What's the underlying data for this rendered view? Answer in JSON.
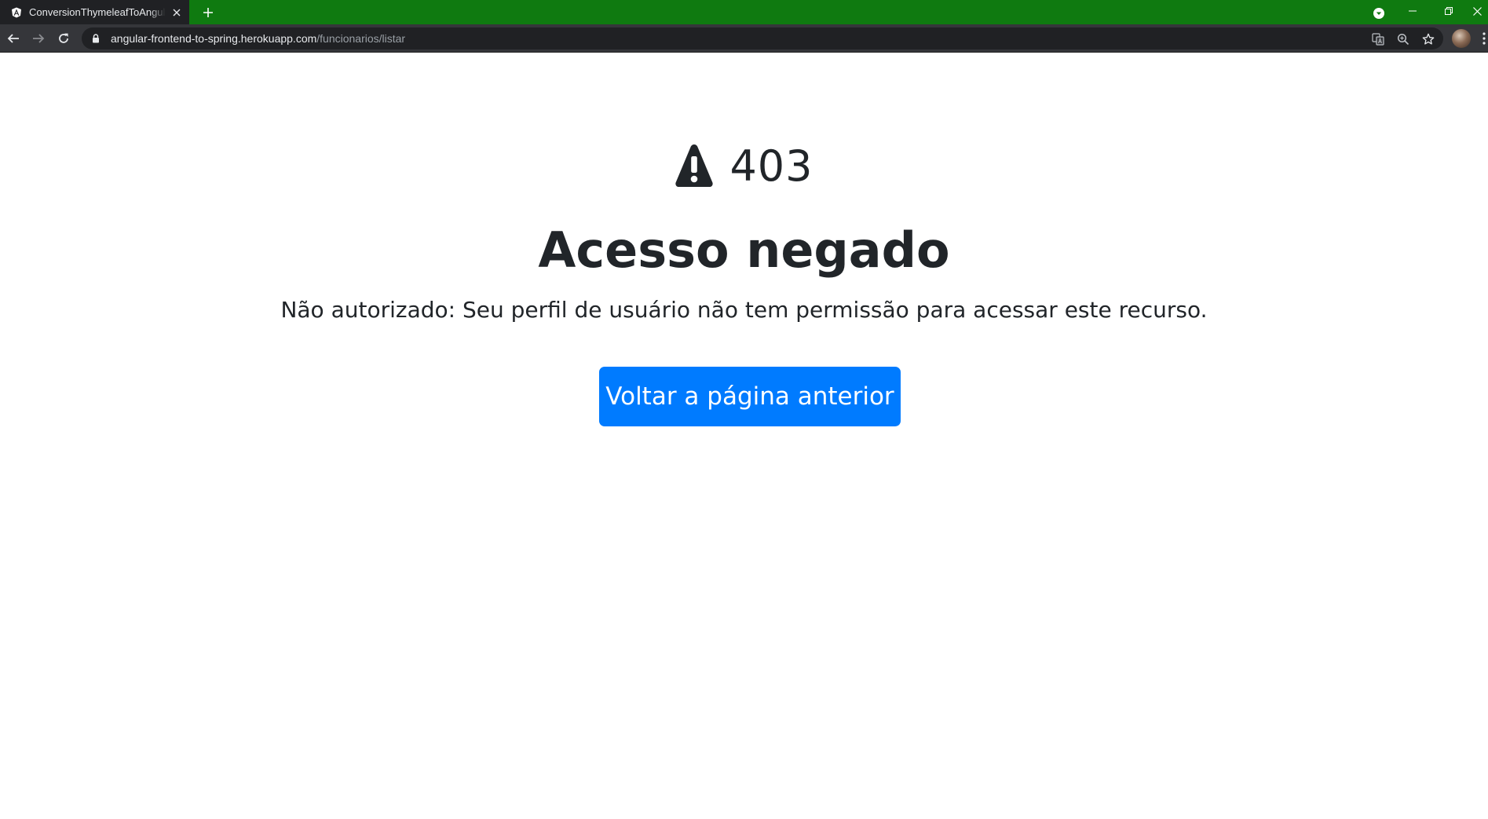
{
  "browser": {
    "tab": {
      "title": "ConversionThymeleafToAngularFrontend",
      "favicon": "angular-icon"
    },
    "url": {
      "host": "angular-frontend-to-spring.herokuapp.com",
      "path": "/funcionarios/listar"
    },
    "colors": {
      "tabstrip": "#0f7a10",
      "toolbar": "#35363a",
      "omnibox": "#202124"
    }
  },
  "page": {
    "status_icon": "warning-triangle-icon",
    "status_code": "403",
    "heading": "Acesso negado",
    "message": "Não autorizado: Seu perfil de usuário não tem permissão para acessar este recurso.",
    "back_button_label": "Voltar a página anterior",
    "colors": {
      "text": "#212529",
      "primary_button": "#007bff"
    }
  }
}
